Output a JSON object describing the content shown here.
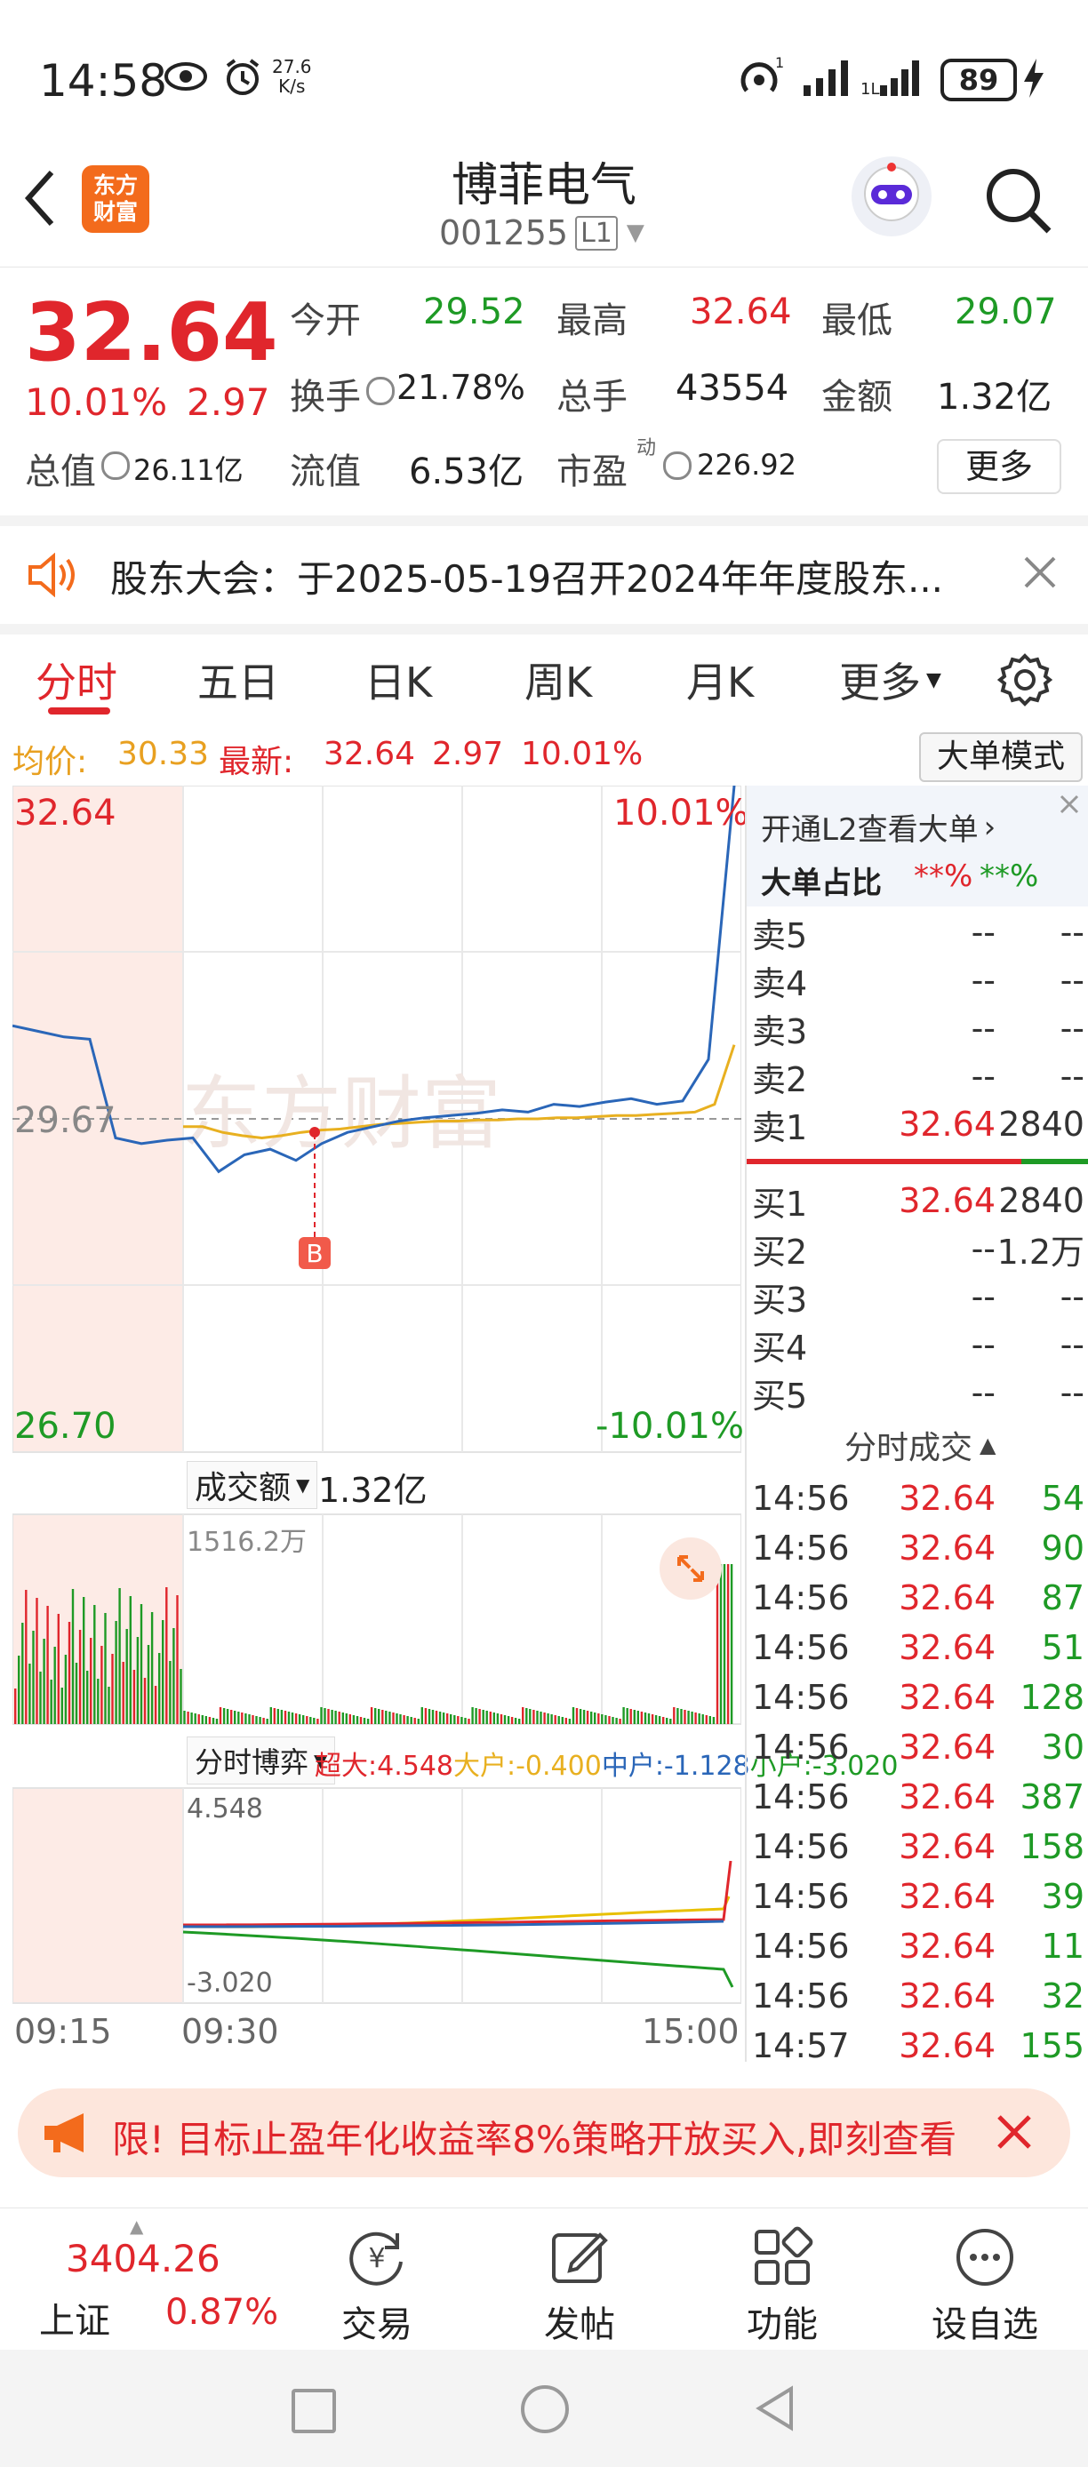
{
  "status_bar": {
    "time": "14:58",
    "net_speed_top": "27.6",
    "net_speed_bottom": "K/s",
    "battery": "89"
  },
  "header": {
    "logo_line1": "东方",
    "logo_line2": "财富",
    "stock_name": "博菲电气",
    "stock_code": "001255",
    "level_badge": "L1"
  },
  "quote": {
    "price": "32.64",
    "change_pct": "10.01%",
    "change_amt": "2.97",
    "open_label": "今开",
    "open": "29.52",
    "high_label": "最高",
    "high": "32.64",
    "low_label": "最低",
    "low": "29.07",
    "turnover_label": "换手",
    "turnover": "21.78%",
    "volume_label": "总手",
    "volume": "43554",
    "amount_label": "金额",
    "amount": "1.32亿",
    "mktcap_label": "总值",
    "mktcap": "26.11亿",
    "float_label": "流值",
    "float": "6.53亿",
    "pe_label": "市盈",
    "pe_sup": "动",
    "pe": "226.92",
    "more_button": "更多"
  },
  "notice": {
    "text": "股东大会：于2025-05-19召开2024年年度股东..."
  },
  "tabs": [
    "分时",
    "五日",
    "日K",
    "周K",
    "月K",
    "更多"
  ],
  "active_tab": 0,
  "info_line": {
    "avg_label": "均价:",
    "avg": "30.33",
    "latest_label": "最新:",
    "latest": "32.64",
    "chg": "2.97",
    "pct": "10.01%",
    "mode_button": "大单模式"
  },
  "chart": {
    "ymax_label": "32.64",
    "ymid_label": "29.67",
    "ymin_label": "26.70",
    "pct_top": "10.01%",
    "pct_bottom": "-10.01%",
    "marker_letter": "B",
    "volume_selector": "成交额",
    "volume_total": "1.32亿",
    "volume_max_label": "1516.2万",
    "game_selector": "分时博弈",
    "game_super": "超大:4.548",
    "game_large": "大户:-0.400",
    "game_medium": "中户:-1.128",
    "game_small": "小户:-3.020",
    "game_max_label": "4.548",
    "game_min_label": "-3.020",
    "time_start": "09:15",
    "time_open": "09:30",
    "time_end": "15:00"
  },
  "chart_data": {
    "type": "line",
    "y_range": [
      26.7,
      32.64
    ],
    "prev_close": 29.67,
    "price_series": [
      30.5,
      30.45,
      30.4,
      30.38,
      29.5,
      29.45,
      29.48,
      29.5,
      29.2,
      29.35,
      29.4,
      29.3,
      29.45,
      29.55,
      29.6,
      29.65,
      29.68,
      29.7,
      29.72,
      29.75,
      29.73,
      29.8,
      29.78,
      29.82,
      29.85,
      29.8,
      29.83,
      30.2,
      32.64
    ],
    "avg_series": [
      29.6,
      29.6,
      29.55,
      29.52,
      29.5,
      29.52,
      29.55,
      29.57,
      29.58,
      29.6,
      29.62,
      29.63,
      29.64,
      29.65,
      29.65,
      29.66,
      29.66,
      29.67,
      29.67,
      29.68,
      29.68,
      29.69,
      29.7,
      29.7,
      29.71,
      29.72,
      29.73,
      29.8,
      30.33
    ]
  },
  "orderbook": {
    "l2_link": "开通L2查看大单",
    "ratio_label": "大单占比",
    "ratio_sell": "**%",
    "ratio_buy": "**%",
    "asks": [
      {
        "label": "卖5",
        "price": "--",
        "vol": "--"
      },
      {
        "label": "卖4",
        "price": "--",
        "vol": "--"
      },
      {
        "label": "卖3",
        "price": "--",
        "vol": "--"
      },
      {
        "label": "卖2",
        "price": "--",
        "vol": "--"
      },
      {
        "label": "卖1",
        "price": "32.64",
        "vol": "2840"
      }
    ],
    "bids": [
      {
        "label": "买1",
        "price": "32.64",
        "vol": "2840"
      },
      {
        "label": "买2",
        "price": "--",
        "vol": "1.2万"
      },
      {
        "label": "买3",
        "price": "--",
        "vol": "--"
      },
      {
        "label": "买4",
        "price": "--",
        "vol": "--"
      },
      {
        "label": "买5",
        "price": "--",
        "vol": "--"
      }
    ],
    "ticks_title": "分时成交",
    "ticks": [
      {
        "time": "14:56",
        "price": "32.64",
        "vol": "54"
      },
      {
        "time": "14:56",
        "price": "32.64",
        "vol": "90"
      },
      {
        "time": "14:56",
        "price": "32.64",
        "vol": "87"
      },
      {
        "time": "14:56",
        "price": "32.64",
        "vol": "51"
      },
      {
        "time": "14:56",
        "price": "32.64",
        "vol": "128"
      },
      {
        "time": "14:56",
        "price": "32.64",
        "vol": "30"
      },
      {
        "time": "14:56",
        "price": "32.64",
        "vol": "387"
      },
      {
        "time": "14:56",
        "price": "32.64",
        "vol": "158"
      },
      {
        "time": "14:56",
        "price": "32.64",
        "vol": "39"
      },
      {
        "time": "14:56",
        "price": "32.64",
        "vol": "11"
      },
      {
        "time": "14:56",
        "price": "32.64",
        "vol": "32"
      },
      {
        "time": "14:57",
        "price": "32.64",
        "vol": "155"
      }
    ]
  },
  "ad_banner": {
    "text": "限!  目标止盈年化收益率8%策略开放买入,即刻查看"
  },
  "bottom_nav": {
    "index_value": "3404.26",
    "index_name": "上证",
    "index_pct": "0.87%",
    "items": [
      "交易",
      "发帖",
      "功能",
      "设自选"
    ]
  },
  "colors": {
    "up": "#e0262c",
    "down": "#1e9a25",
    "avg": "#e8b020",
    "price_line": "#2a66b8",
    "accent": "#f36b1c"
  }
}
